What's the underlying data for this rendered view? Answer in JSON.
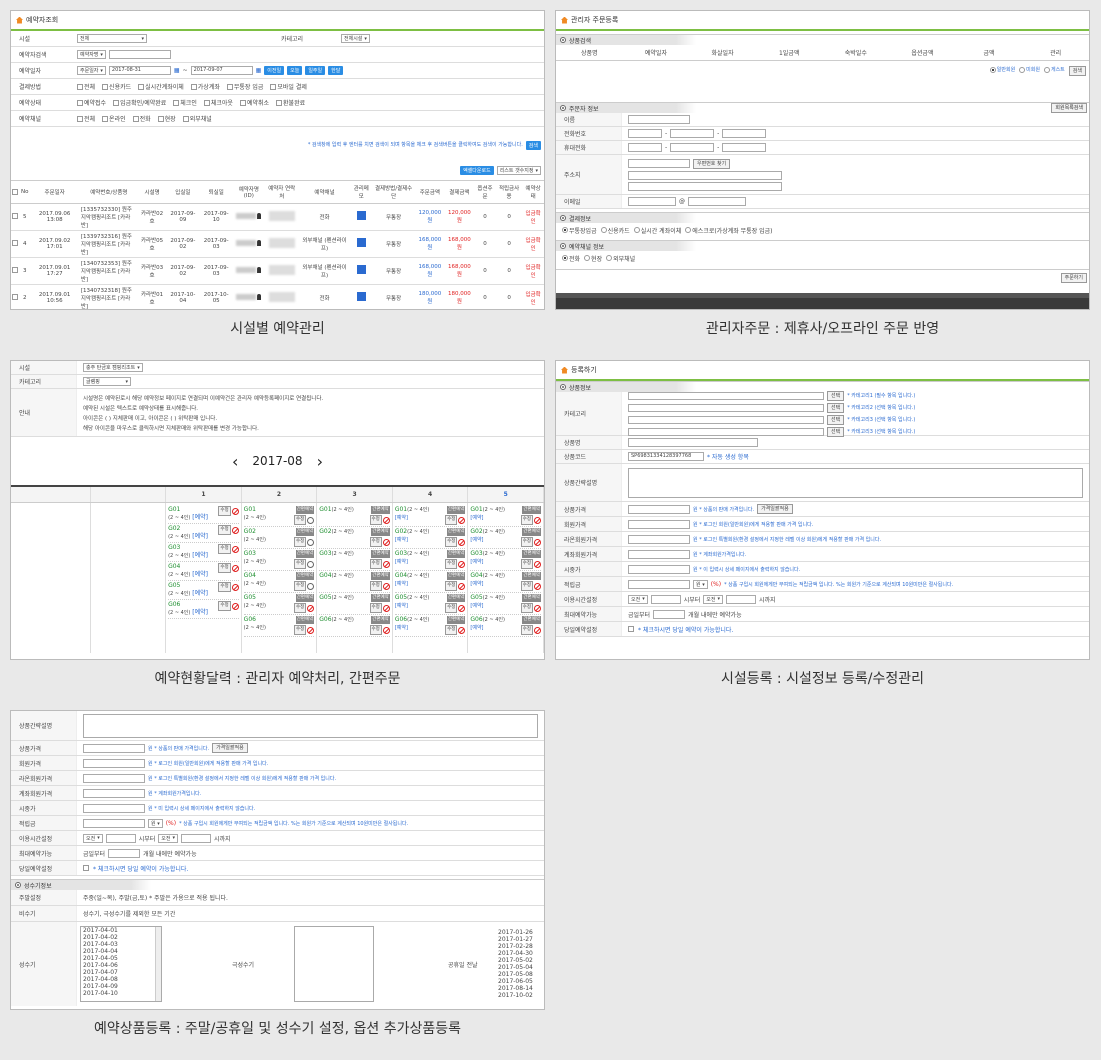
{
  "p1": {
    "title": "예약자조회",
    "rows": {
      "facility": {
        "label": "시설",
        "value": "전체",
        "cat_label": "카테고리",
        "cat_value": "전체시설"
      },
      "keyword": {
        "label": "예약자검색",
        "select": "예약자명"
      },
      "date": {
        "label": "예약일자",
        "select": "주문일자",
        "from": "2017-08-31",
        "to": "2017-09-07",
        "btns": [
          "이전일",
          "오늘",
          "일주일",
          "한달"
        ]
      },
      "pay": {
        "label": "결제방법",
        "opts": [
          "전체",
          "신용카드",
          "실시간계좌이체",
          "가상계좌",
          "무통장 입금",
          "모바일 결제"
        ]
      },
      "status": {
        "label": "예약상태",
        "opts": [
          "예약접수",
          "입금확인/예약완료",
          "체크인",
          "체크아웃",
          "예약취소",
          "환불완료"
        ]
      },
      "channel": {
        "label": "예약채널",
        "opts": [
          "전체",
          "온라인",
          "전화",
          "현장",
          "외부채널"
        ]
      }
    },
    "notice": "* 검색창에 입력 후 엔터를 치면 검색이 되며 항목을 체크 후 검색버튼을 클릭하여도 검색이 가능합니다.",
    "search_btn": "검색",
    "excel_btn": "엑셀다운로드",
    "list_sel": "리스트 갯수지정",
    "headers": [
      "No",
      "주문일자",
      "예약번호/상품명",
      "시설명",
      "입실일",
      "퇴실일",
      "예약자명(ID)",
      "예약자 연락처",
      "예약채널",
      "관리메모",
      "결제방법/결제수단",
      "주문금액",
      "결제금액",
      "옵션주문",
      "적립금사용",
      "예약상태"
    ],
    "rows_data": [
      {
        "no": "5",
        "date": "2017.09.06 13:08",
        "order": "[1335732330] 원주 지악캠핑리조트 [카라반]",
        "fac": "카라반02호",
        "in": "2017-09-09",
        "out": "2017-09-10",
        "ch": "전화",
        "pay": "무통장",
        "amt": "120,000원",
        "paid": "120,000원",
        "opt": "0",
        "pt": "0",
        "st": "입금확인"
      },
      {
        "no": "4",
        "date": "2017.09.02 17:01",
        "order": "[1339732316] 원주 지악캠핑리조트 [카라반]",
        "fac": "카라반05호",
        "in": "2017-09-02",
        "out": "2017-09-03",
        "ch": "외부채널 (펜션라이프)",
        "pay": "무통장",
        "amt": "168,000원",
        "paid": "168,000원",
        "opt": "0",
        "pt": "0",
        "st": "입금확인"
      },
      {
        "no": "3",
        "date": "2017.09.01 17:27",
        "order": "[1340732353] 원주 지악캠핑리조트 [카라반]",
        "fac": "카라반03호",
        "in": "2017-09-02",
        "out": "2017-09-03",
        "ch": "외부채널 (펜션라이프)",
        "pay": "무통장",
        "amt": "168,000원",
        "paid": "168,000원",
        "opt": "0",
        "pt": "0",
        "st": "입금확인"
      },
      {
        "no": "2",
        "date": "2017.09.01 10:56",
        "order": "[1340732318] 원주 지악캠핑리조트 [카라반]",
        "fac": "카라반01호",
        "in": "2017-10-04",
        "out": "2017-10-05",
        "ch": "전화",
        "pay": "무통장",
        "amt": "180,000원",
        "paid": "180,000원",
        "opt": "0",
        "pt": "0",
        "st": "입금확인"
      }
    ]
  },
  "p2": {
    "title": "관리자 주문등록",
    "sec1": "상품검색",
    "headers": [
      "상품명",
      "예약일자",
      "화살일자",
      "1일금액",
      "숙박일수",
      "옵션금액",
      "금액",
      "관리"
    ],
    "radio": [
      "일반회원",
      "미회원",
      "게스트"
    ],
    "search_btn": "검색",
    "sec2": "주문자 정보",
    "member_btn": "회원목록검색",
    "fields": [
      "이름",
      "전화번호",
      "휴대전화",
      "주소지",
      "이메일"
    ],
    "zip_btn": "우편번호 찾기",
    "sec3": "결제정보",
    "pay_opts": [
      "무통장입금",
      "신용카드",
      "실시간 계좌이체",
      "에스크로(가상계좌 무통장 입금)"
    ],
    "sec4": "예약채널 정보",
    "ch_opts": [
      "전화",
      "현장",
      "외부채널"
    ],
    "order_btn": "주문하기"
  },
  "p3": {
    "facility": {
      "label": "시설",
      "value": "충주 탄금호 캠핑리조트"
    },
    "category": {
      "label": "카테고리",
      "value": "글램핑"
    },
    "guide_label": "안내",
    "guide": [
      "시설명은 예약된로시 해당 예약정보 페이지로 연결되며 이예약건은 관리자 예약등록페이지로 연결됩니다.",
      "예약된 시설은 텍스트로 예약상태를 표시해줍니다.",
      "아이콘은 ( ) 지체판매 이고, 아이콘은 ( ) 위탁판매 입니다.",
      "해당 아이콘을 마우스로 클릭하시면 지체판매와 위탁판매를 변경 가능합니다."
    ],
    "month": "2017-08",
    "days": [
      "1",
      "2",
      "3",
      "4",
      "5"
    ],
    "cap": "(2 ~ 4인)",
    "edit": "수정",
    "quick": "간편예약",
    "reserved": "[예약]"
  },
  "p4": {
    "title": "등록하기",
    "sec": "상품정보",
    "cat_label": "카테고리",
    "cat_btn": "선택",
    "cat_notes": [
      "* 카테고리1 (필수 항목 입니다.)",
      "* 카테고리2 (선택 항목 입니다.)",
      "* 카테고리3 (선택 항목 입니다.)",
      "* 카테고리3 (선택 항목 입니다.)"
    ],
    "name_label": "상품명",
    "code_label": "상품코드",
    "code_value": "SP69831334128397768",
    "code_note": "* 자동 생성 항목",
    "desc_label": "상품간략설명",
    "price_rows": [
      {
        "label": "상품가격",
        "note": "원 * 상품의 판매 가격입니다.",
        "btn": "가격일괄적용"
      },
      {
        "label": "회원가격",
        "note": "원 * 로그인 회원(일반회원)에게 적용할 판매 가격 입니다."
      },
      {
        "label": "라온회원가격",
        "note": "원 * 로그인 특별회원(환경 설정에서 지정한 레벨 이상 회원)에게 적용할 판매 가격 입니다."
      },
      {
        "label": "계좌회원가격",
        "note": "원 * 계좌회원가격입니다."
      },
      {
        "label": "시중가",
        "note": "원 * 이 입력시 상세 페이지에서 출력하지 않습니다."
      }
    ],
    "point_label": "적립금",
    "point_note": "* 상품 구입시 회원에게만 부여되는 적립금액 입니다. %는 회원가 기준으로 계산되며 10원미만은 절사됩니다.",
    "time_label": "이용시간설정",
    "time_from": "오전",
    "time_to": "오전",
    "max_label": "최대예약가능",
    "max_txt": "금일부터",
    "max_note": "개월 내에만 예약가능",
    "day_label": "당일예약설정",
    "day_note": "* 체크하시면 당일 예약이 가능합니다."
  },
  "p5": {
    "desc_label": "상품간략설명",
    "price_rows": [
      {
        "label": "상품가격",
        "note": "원 * 상품의 판매 가격입니다.",
        "btn": "가격일괄적용"
      },
      {
        "label": "회원가격",
        "note": "원 * 로그인 회원(일반회원)에게 적용할 판매 가격 입니다."
      },
      {
        "label": "라온회원가격",
        "note": "원 * 로그인 특별회원(환경 설정에서 지정한 레벨 이상 회원)에게 적용할 판매 가격 입니다."
      },
      {
        "label": "계좌회원가격",
        "note": "원 * 계좌회원가격입니다."
      },
      {
        "label": "시중가",
        "note": "원 * 미 입력시 상세 페이지에서 출력하지 않습니다."
      }
    ],
    "point_label": "적립금",
    "point_note": "* 상품 구입시 회원에게만 부여되는 적립금액 입니다. %는 회원가 기준으로 계산되며 10원미만은 절사됩니다.",
    "time_label": "이용시간설정",
    "max_label": "최대예약가능",
    "day_label": "당일예약설정",
    "sec": "성수기정보",
    "weekend_label": "주말설정",
    "weekend_val": "주중(일~목), 주말(금,토) * 주말은 가용으로 적용 됩니다.",
    "off_label": "비수기",
    "off_val": "성수기, 극성수기를 제외한 모든 기간",
    "peak_label": "성수기",
    "peak_dates": [
      "2017-04-01",
      "2017-04-02",
      "2017-04-03",
      "2017-04-04",
      "2017-04-05",
      "2017-04-06",
      "2017-04-07",
      "2017-04-08",
      "2017-04-09",
      "2017-04-10"
    ],
    "superpeak_label": "극성수기",
    "holiday_label": "공휴일 전날",
    "holiday_dates": [
      "2017-01-26",
      "2017-01-27",
      "2017-02-28",
      "2017-04-30",
      "2017-05-02",
      "2017-05-04",
      "2017-05-08",
      "2017-06-05",
      "2017-08-14",
      "2017-10-02"
    ]
  },
  "captions": [
    "시설별 예약관리",
    "관리자주문 : 제휴사/오프라인 주문 반영",
    "예약현황달력 : 관리자 예약처리, 간편주문",
    "시설등록 : 시설정보 등록/수정관리",
    "예약상품등록 : 주말/공휴일 및 성수기 설정, 옵션 추가상품등록"
  ]
}
